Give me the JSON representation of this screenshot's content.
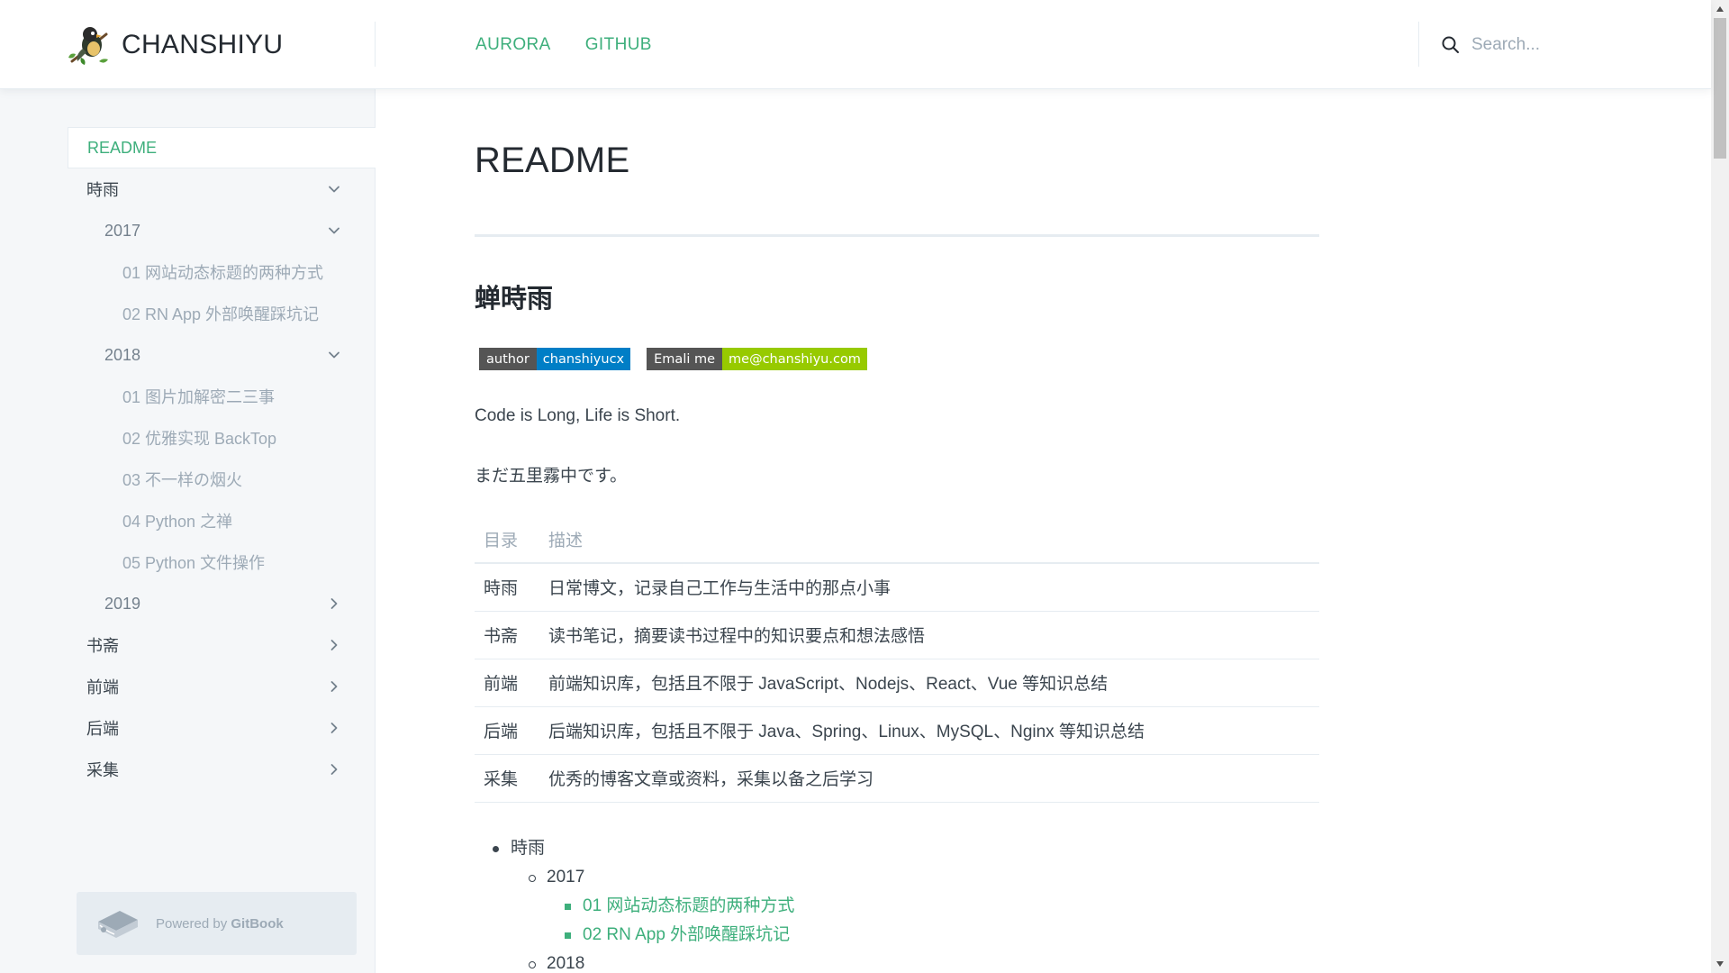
{
  "header": {
    "site_title": "CHANSHIYU",
    "nav": [
      "AURORA",
      "GITHUB"
    ],
    "search_placeholder": "Search..."
  },
  "sidebar": {
    "items": [
      {
        "label": "README",
        "level": 0,
        "active": true,
        "chevron": "none"
      },
      {
        "label": "時雨",
        "level": 0,
        "chevron": "down"
      },
      {
        "label": "2017",
        "level": 1,
        "chevron": "down"
      },
      {
        "label": "01 网站动态标题的两种方式",
        "level": 2,
        "chevron": "none"
      },
      {
        "label": "02 RN App 外部唤醒踩坑记",
        "level": 2,
        "chevron": "none"
      },
      {
        "label": "2018",
        "level": 1,
        "chevron": "down"
      },
      {
        "label": "01 图片加解密二三事",
        "level": 2,
        "chevron": "none"
      },
      {
        "label": "02 优雅实现 BackTop",
        "level": 2,
        "chevron": "none"
      },
      {
        "label": "03 不一样の烟火",
        "level": 2,
        "chevron": "none"
      },
      {
        "label": "04 Python 之禅",
        "level": 2,
        "chevron": "none"
      },
      {
        "label": "05 Python 文件操作",
        "level": 2,
        "chevron": "none"
      },
      {
        "label": "2019",
        "level": 1,
        "chevron": "right"
      },
      {
        "label": "书斋",
        "level": 0,
        "chevron": "right"
      },
      {
        "label": "前端",
        "level": 0,
        "chevron": "right"
      },
      {
        "label": "后端",
        "level": 0,
        "chevron": "right"
      },
      {
        "label": "采集",
        "level": 0,
        "chevron": "right"
      }
    ],
    "powered_prefix": "Powered by ",
    "powered_brand": "GitBook"
  },
  "main": {
    "title": "README",
    "heading": "蝉時雨",
    "badges": [
      {
        "left": "author",
        "right": "chanshiyucx",
        "color": "#007ec6"
      },
      {
        "left": "Emali me",
        "right": "me@chanshiyu.com",
        "color": "#97ca00"
      }
    ],
    "paragraph1": "Code is Long, Life is Short.",
    "paragraph2": "まだ五里霧中です。",
    "table": {
      "headers": [
        "目录",
        "描述"
      ],
      "rows": [
        [
          "時雨",
          "日常博文，记录自己工作与生活中的那点小事"
        ],
        [
          "书斋",
          "读书笔记，摘要读书过程中的知识要点和想法感悟"
        ],
        [
          "前端",
          "前端知识库，包括且不限于 JavaScript、Nodejs、React、Vue 等知识总结"
        ],
        [
          "后端",
          "后端知识库，包括且不限于 Java、Spring、Linux、MySQL、Nginx 等知识总结"
        ],
        [
          "采集",
          "优秀的博客文章或资料，采集以备之后学习"
        ]
      ]
    },
    "list": [
      {
        "text": "時雨",
        "level": 0,
        "link": false
      },
      {
        "text": "2017",
        "level": 1,
        "link": false
      },
      {
        "text": "01 网站动态标题的两种方式",
        "level": 2,
        "link": true
      },
      {
        "text": "02 RN App 外部唤醒踩坑记",
        "level": 2,
        "link": true
      },
      {
        "text": "2018",
        "level": 1,
        "link": false
      }
    ]
  },
  "colors": {
    "accent": "#3eaf7c",
    "sidebar_bg": "#f5f7f9",
    "border": "#e6ecf1",
    "text": "#3b454e"
  }
}
